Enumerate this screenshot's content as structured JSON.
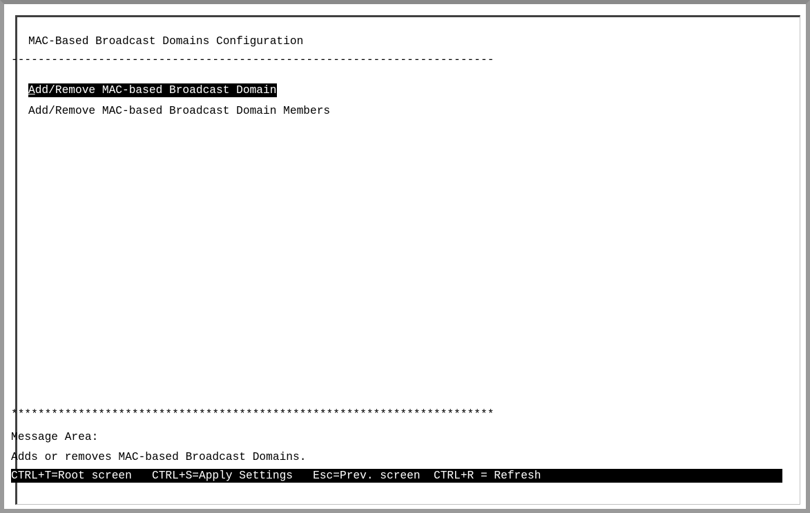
{
  "screen": {
    "title": "MAC-Based Broadcast Domains Configuration",
    "separator": "------------------------------------------------------------------------",
    "menu_items": [
      {
        "label": "Add/Remove MAC-based Broadcast Domain",
        "selected": true
      },
      {
        "label": "Add/Remove MAC-based Broadcast Domain Members",
        "selected": false
      }
    ],
    "star_separator": "************************************************************************"
  },
  "message_area": {
    "label": "Message Area:",
    "text": "Adds or removes MAC-based Broadcast Domains."
  },
  "hotkey_bar": {
    "text": "CTRL+T=Root screen   CTRL+S=Apply Settings   Esc=Prev. screen  CTRL+R = Refresh"
  },
  "colors": {
    "background": "#ffffff",
    "text": "#000000",
    "highlight_bg": "#000000",
    "highlight_text": "#ffffff"
  }
}
